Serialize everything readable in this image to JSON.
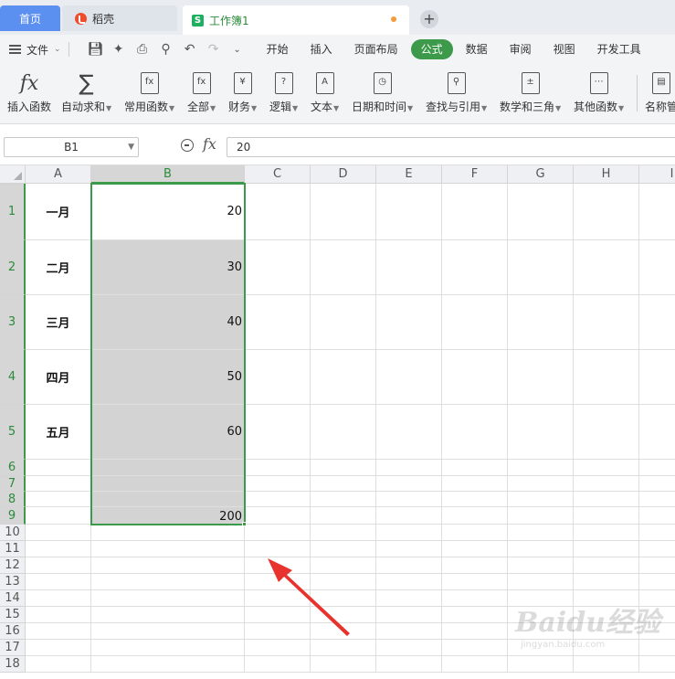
{
  "tabs": {
    "home": "首页",
    "daoke": "稻壳",
    "workbook": "工作簿1",
    "add_symbol": "+"
  },
  "menu": {
    "file_label": "文件",
    "tabs": [
      "开始",
      "插入",
      "页面布局",
      "公式",
      "数据",
      "审阅",
      "视图",
      "开发工具"
    ],
    "active_tab": "公式"
  },
  "ribbon": {
    "items": [
      {
        "label": "插入函数",
        "icon": "fx-icon",
        "dropdown": false
      },
      {
        "label": "自动求和",
        "icon": "sigma-icon",
        "dropdown": true
      },
      {
        "label": "常用函数",
        "icon": "common-functions-icon",
        "dropdown": true
      },
      {
        "label": "全部",
        "icon": "all-functions-icon",
        "dropdown": true
      },
      {
        "label": "财务",
        "icon": "finance-icon",
        "dropdown": true
      },
      {
        "label": "逻辑",
        "icon": "logic-icon",
        "dropdown": true
      },
      {
        "label": "文本",
        "icon": "text-icon",
        "dropdown": true
      },
      {
        "label": "日期和时间",
        "icon": "date-time-icon",
        "dropdown": true
      },
      {
        "label": "查找与引用",
        "icon": "lookup-icon",
        "dropdown": true
      },
      {
        "label": "数学和三角",
        "icon": "math-icon",
        "dropdown": true
      },
      {
        "label": "其他函数",
        "icon": "other-functions-icon",
        "dropdown": true
      },
      {
        "label": "名称管",
        "icon": "name-manager-icon",
        "dropdown": false
      }
    ]
  },
  "formula_bar": {
    "name_box": "B1",
    "formula": "20"
  },
  "grid": {
    "columns": [
      "A",
      "B",
      "C",
      "D",
      "E",
      "F",
      "G",
      "H",
      "I"
    ],
    "selected_column": "B",
    "rows": [
      "1",
      "2",
      "3",
      "4",
      "5",
      "6",
      "7",
      "8",
      "9",
      "10",
      "11",
      "12",
      "13",
      "14",
      "15",
      "16",
      "17",
      "18"
    ],
    "col_a": [
      "一月",
      "二月",
      "三月",
      "四月",
      "五月",
      "",
      "",
      "",
      ""
    ],
    "col_b": [
      "20",
      "30",
      "40",
      "50",
      "60",
      "",
      "",
      "",
      "200"
    ]
  },
  "colors": {
    "accent_green": "#3c9a4a",
    "home_tab_blue": "#5b8ff0",
    "arrow_red": "#e8322d",
    "selection_fill": "#d3d3d3"
  },
  "watermark": {
    "brand": "Baidu经验",
    "url": "jingyan.baidu.com"
  }
}
